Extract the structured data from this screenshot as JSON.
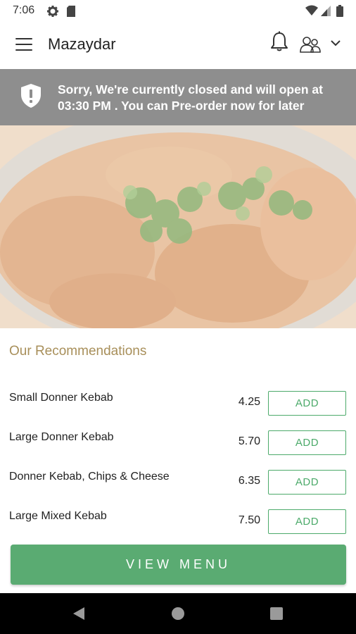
{
  "status_bar": {
    "time": "7:06"
  },
  "header": {
    "title": "Mazaydar"
  },
  "banner": {
    "message": "Sorry, We're currently closed and will open at 03:30 PM . You can Pre-order now for later"
  },
  "recommendations": {
    "title": "Our Recommendations",
    "add_label": "ADD",
    "items": [
      {
        "name": "Small Donner Kebab",
        "price": "4.25"
      },
      {
        "name": "Large Donner Kebab",
        "price": "5.70"
      },
      {
        "name": "Donner Kebab, Chips & Cheese",
        "price": "6.35"
      },
      {
        "name": "Large Mixed Kebab",
        "price": "7.50"
      }
    ]
  },
  "footer": {
    "view_menu_label": "VIEW MENU"
  },
  "colors": {
    "accent_green": "#5aab72",
    "banner_gray": "#8e8e8e",
    "section_title": "#a88f5a"
  }
}
